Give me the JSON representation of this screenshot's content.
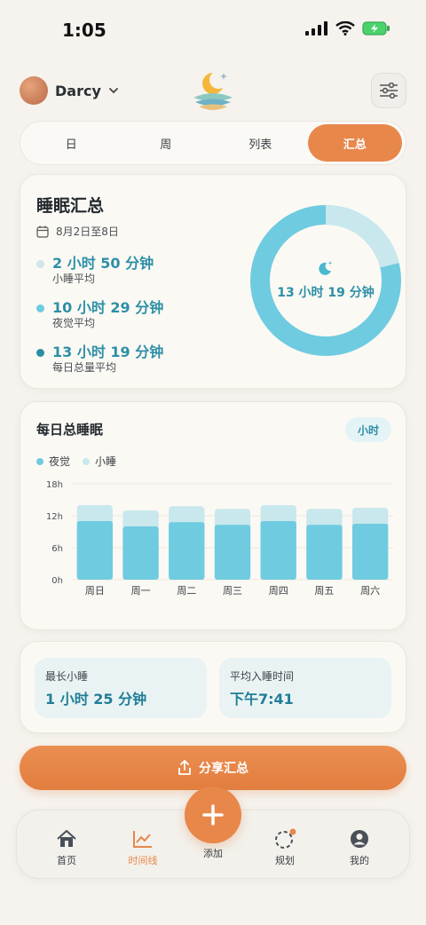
{
  "status_bar": {
    "time": "1:05"
  },
  "header": {
    "profile_name": "Darcy"
  },
  "tabs": [
    {
      "label": "日",
      "active": false
    },
    {
      "label": "周",
      "active": false
    },
    {
      "label": "列表",
      "active": false
    },
    {
      "label": "汇总",
      "active": true
    }
  ],
  "summary": {
    "title": "睡眠汇总",
    "date_range": "8月2日至8日",
    "stats": [
      {
        "value": "2 小时 50 分钟",
        "label": "小睡平均",
        "color": "#cde7ec"
      },
      {
        "value": "10 小时 29 分钟",
        "label": "夜觉平均",
        "color": "#6fcbe0"
      },
      {
        "value": "13 小时 19 分钟",
        "label": "每日总量平均",
        "color": "#2a8ea3"
      }
    ],
    "donut_center": "13 小时 19 分钟",
    "donut_split": {
      "night": 10.48,
      "nap": 2.83
    }
  },
  "daily_chart": {
    "title": "每日总睡眠",
    "unit_button": "小时",
    "legend": [
      {
        "label": "夜觉",
        "color": "#6fcbe0"
      },
      {
        "label": "小睡",
        "color": "#c9e8ee"
      }
    ]
  },
  "chart_data": {
    "type": "bar",
    "stacked": true,
    "categories": [
      "周日",
      "周一",
      "周二",
      "周三",
      "周四",
      "周五",
      "周六"
    ],
    "series": [
      {
        "name": "夜觉",
        "values": [
          11,
          10,
          10.8,
          10.3,
          11,
          10.3,
          10.5
        ]
      },
      {
        "name": "小睡",
        "values": [
          3,
          3,
          3,
          3,
          3,
          3,
          3
        ]
      }
    ],
    "yticks": [
      "0h",
      "6h",
      "12h",
      "18h"
    ],
    "ylim": [
      0,
      18
    ],
    "grid": true
  },
  "insights": [
    {
      "label": "最长小睡",
      "value": "1 小时 25 分钟"
    },
    {
      "label": "平均入睡时间",
      "value": "下午7:41"
    }
  ],
  "share_button": "分享汇总",
  "bottom_nav": [
    {
      "label": "首页",
      "icon": "home-icon",
      "active": false
    },
    {
      "label": "时间线",
      "icon": "timeline-chart-icon",
      "active": true
    },
    {
      "label": "规划",
      "icon": "plan-circle-icon",
      "active": false
    },
    {
      "label": "我的",
      "icon": "profile-icon",
      "active": false
    }
  ],
  "fab_label": "添加",
  "accent_color": "#e8874a"
}
